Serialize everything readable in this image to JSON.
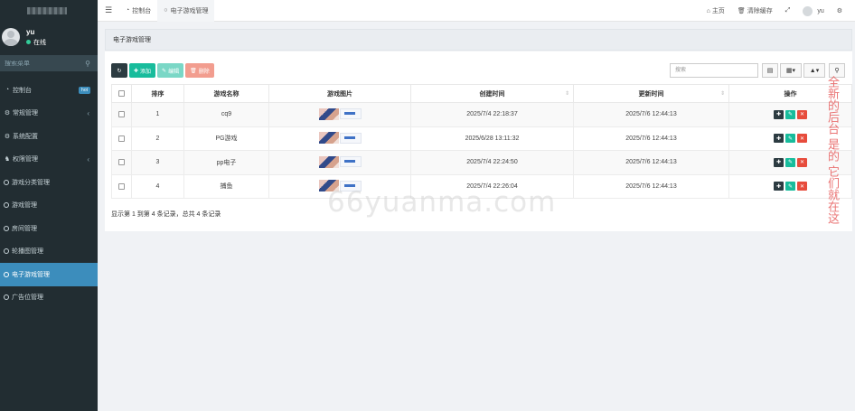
{
  "sidebar": {
    "user": {
      "name": "yu",
      "status": "在线"
    },
    "search_placeholder": "搜索菜单",
    "items": [
      {
        "label": "控制台",
        "icon": "dashboard-icon",
        "badge": "hot"
      },
      {
        "label": "常规管理",
        "icon": "cogs-icon",
        "has_children": true
      },
      {
        "label": "系统配置",
        "icon": "gear-icon"
      },
      {
        "label": "权限管理",
        "icon": "group-icon",
        "has_children": true
      },
      {
        "label": "游戏分类管理",
        "icon": "circle-icon"
      },
      {
        "label": "游戏管理",
        "icon": "circle-icon"
      },
      {
        "label": "房间管理",
        "icon": "circle-icon"
      },
      {
        "label": "轮播图管理",
        "icon": "circle-icon"
      },
      {
        "label": "电子游戏管理",
        "icon": "circle-icon",
        "active": true
      },
      {
        "label": "广告位管理",
        "icon": "circle-icon"
      }
    ]
  },
  "topbar": {
    "tabs": [
      {
        "label": "控制台",
        "icon": "dashboard-icon"
      },
      {
        "label": "电子游戏管理",
        "icon": "circle-icon",
        "active": true
      }
    ],
    "home": "主页",
    "clear_cache": "清除缓存",
    "user": "yu"
  },
  "content": {
    "title": "电子游戏管理",
    "toolbar": {
      "add": "添加",
      "edit": "编辑",
      "delete": "删除"
    },
    "search_placeholder": "搜索",
    "columns": [
      "排序",
      "游戏名称",
      "游戏图片",
      "创建时间",
      "更新时间",
      "操作"
    ],
    "rows": [
      {
        "order": "1",
        "name": "cq9",
        "created": "2025/7/4 22:18:37",
        "updated": "2025/7/6 12:44:13"
      },
      {
        "order": "2",
        "name": "PG游戏",
        "created": "2025/6/28 13:11:32",
        "updated": "2025/7/6 12:44:13"
      },
      {
        "order": "3",
        "name": "pp电子",
        "created": "2025/7/4 22:24:50",
        "updated": "2025/7/6 12:44:13"
      },
      {
        "order": "4",
        "name": "捕鱼",
        "created": "2025/7/4 22:26:04",
        "updated": "2025/7/6 12:44:13"
      }
    ],
    "pagination": "显示第 1 到第 4 条记录，总共 4 条记录"
  },
  "overlay": {
    "watermark": "66yuanma.com",
    "note": "全新的后台 是的 它们就在这"
  },
  "colors": {
    "sidebar_bg": "#222d32",
    "active": "#3c8dbc",
    "success": "#18bc9c",
    "danger": "#e74c3c"
  }
}
